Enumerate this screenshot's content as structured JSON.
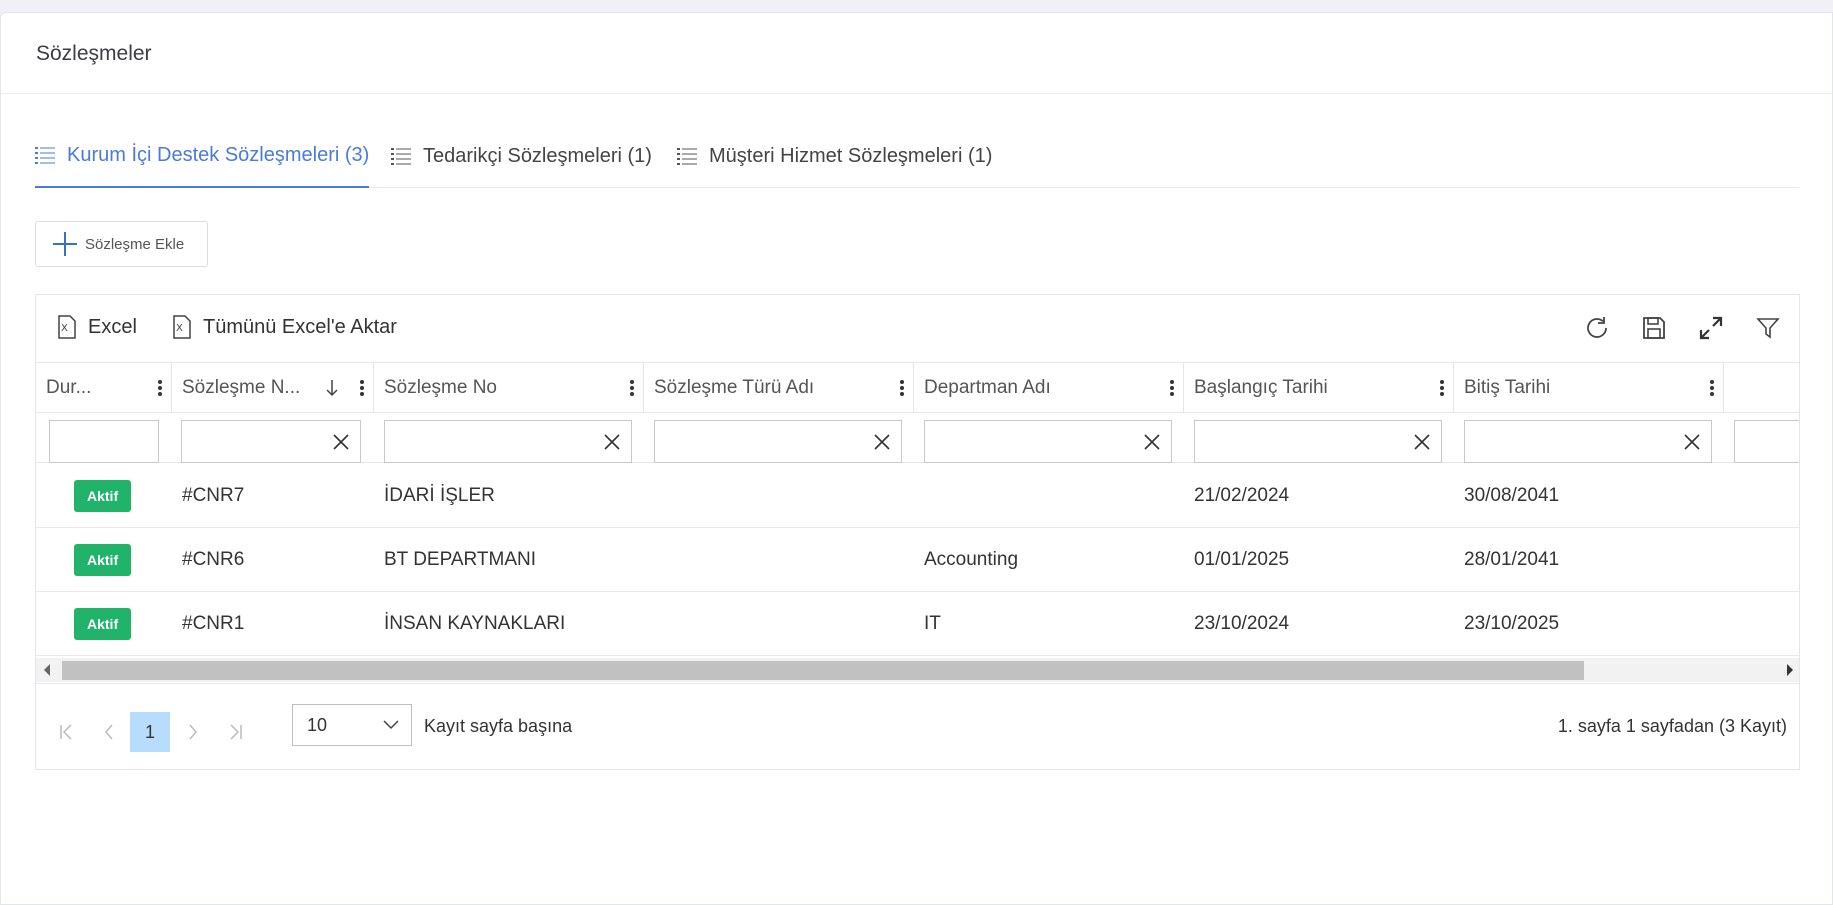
{
  "page": {
    "title": "Sözleşmeler"
  },
  "tabs": [
    {
      "label": "Kurum İçi Destek Sözleşmeleri (3)",
      "active": true
    },
    {
      "label": "Tedarikçi Sözleşmeleri (1)",
      "active": false
    },
    {
      "label": "Müşteri Hizmet Sözleşmeleri (1)",
      "active": false
    }
  ],
  "add_button": {
    "label": "Sözleşme Ekle"
  },
  "toolbar": {
    "excel_label": "Excel",
    "export_all_label": "Tümünü Excel'e Aktar",
    "icons": [
      "refresh-icon",
      "save-icon",
      "fullscreen-icon",
      "filter-icon"
    ]
  },
  "columns": [
    {
      "label": "Dur..."
    },
    {
      "label": "Sözleşme N..."
    },
    {
      "label": "Sözleşme No"
    },
    {
      "label": "Sözleşme Türü Adı"
    },
    {
      "label": "Departman Adı"
    },
    {
      "label": "Başlangıç Tarihi"
    },
    {
      "label": "Bitiş Tarihi"
    }
  ],
  "rows": [
    {
      "status": "Aktif",
      "code": "#CNR7",
      "name": "İDARİ İŞLER",
      "type": "",
      "department": "",
      "start": "21/02/2024",
      "end": "30/08/2041"
    },
    {
      "status": "Aktif",
      "code": "#CNR6",
      "name": "BT DEPARTMANI",
      "type": "",
      "department": "Accounting",
      "start": "01/01/2025",
      "end": "28/01/2041"
    },
    {
      "status": "Aktif",
      "code": "#CNR1",
      "name": "İNSAN KAYNAKLARI",
      "type": "",
      "department": "IT",
      "start": "23/10/2024",
      "end": "23/10/2025"
    }
  ],
  "pager": {
    "current_page": "1",
    "page_size": "10",
    "page_size_label": "Kayıt sayfa başına",
    "info": "1. sayfa 1 sayfadan (3 Kayıt)"
  },
  "colors": {
    "accent": "#4a7bd6",
    "status_active": "#21b36a",
    "page_active": "#b8dcfb"
  }
}
